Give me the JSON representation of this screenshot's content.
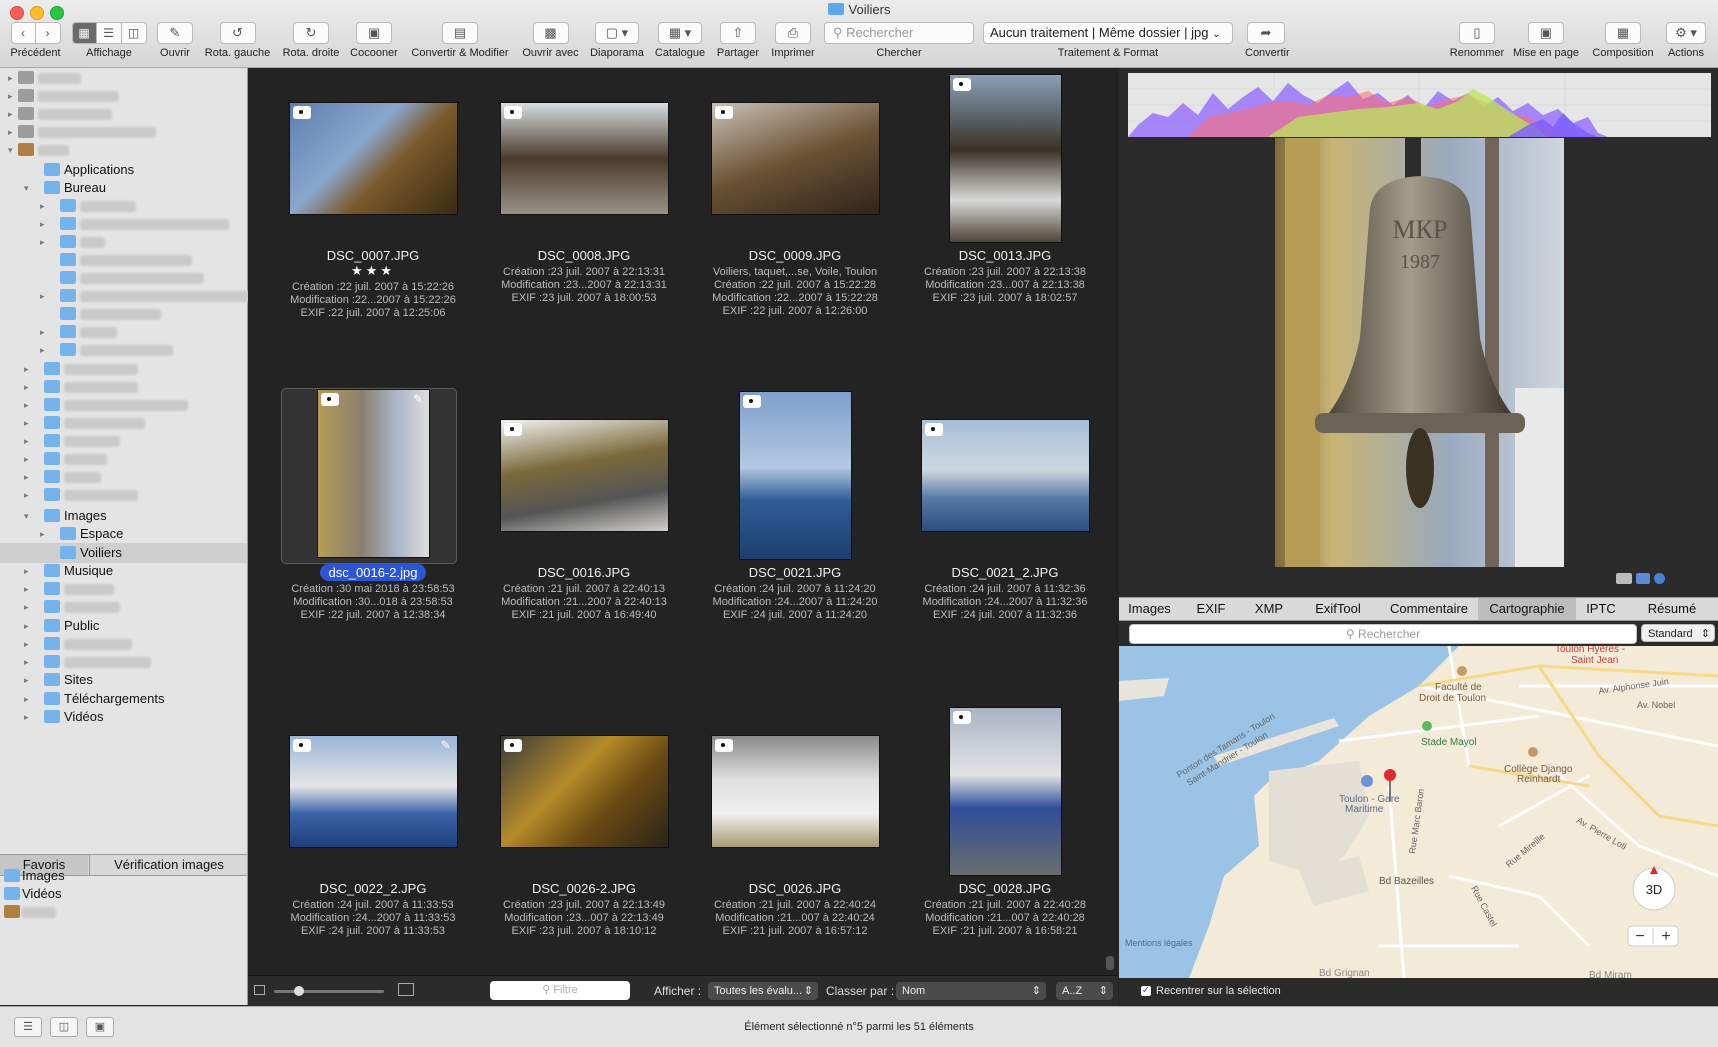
{
  "window": {
    "title": "Voiliers"
  },
  "toolbar": {
    "precedent": "Précédent",
    "affichage": "Affichage",
    "ouvrir": "Ouvrir",
    "rota_gauche": "Rota. gauche",
    "rota_droite": "Rota. droite",
    "cocooner": "Cocooner",
    "convertir_modifier": "Convertir & Modifier",
    "ouvrir_avec": "Ouvrir avec",
    "diaporama": "Diaporama",
    "catalogue": "Catalogue",
    "partager": "Partager",
    "imprimer": "Imprimer",
    "search_placeholder": "Rechercher",
    "chercher": "Chercher",
    "traitement_value": "Aucun traitement | Même dossier | jpg",
    "traitement_label": "Traitement & Format",
    "convertir": "Convertir",
    "renommer": "Renommer",
    "mise_en_page": "Mise en page",
    "composition": "Composition",
    "actions": "Actions"
  },
  "sidebar": {
    "rows": [
      {
        "label": "Mercure",
        "blurred": true,
        "level": 0
      },
      {
        "label": "macoft – sauv",
        "blurred": true,
        "level": 0
      },
      {
        "label": "Time Machine",
        "blurred": true,
        "level": 0
      },
      {
        "label": "GraphicConverter 10",
        "blurred": true,
        "level": 0
      },
      {
        "label": "macof",
        "blurred": true,
        "level": 0
      },
      {
        "label": "Applications",
        "blurred": false,
        "level": 1
      },
      {
        "label": "Bureau",
        "blurred": false,
        "level": 1
      },
      {
        "label": "Activites",
        "blurred": true,
        "level": 2
      },
      {
        "label": "Activites personnalisees",
        "blurred": true,
        "level": 2
      },
      {
        "label": "BBBB",
        "blurred": true,
        "level": 2
      },
      {
        "label": "dossier sans titre",
        "blurred": true,
        "level": 2
      },
      {
        "label": "dossier sans titre 2",
        "blurred": true,
        "level": 2
      },
      {
        "label": "Exemple d'arbre généalogique",
        "blurred": true,
        "level": 2
      },
      {
        "label": "Julia Roberts",
        "blurred": true,
        "level": 2
      },
      {
        "label": "photos",
        "blurred": true,
        "level": 2
      },
      {
        "label": "Présentation DC",
        "blurred": true,
        "level": 2
      },
      {
        "label": "Cloud Mac VF",
        "blurred": true,
        "level": 1
      },
      {
        "label": "CloudStation",
        "blurred": true,
        "level": 1
      },
      {
        "label": "Creative Cloud Files",
        "blurred": true,
        "level": 1
      },
      {
        "label": "Developpement",
        "blurred": true,
        "level": 1
      },
      {
        "label": "Documents",
        "blurred": true,
        "level": 1
      },
      {
        "label": "Dropbox",
        "blurred": true,
        "level": 1
      },
      {
        "label": "Github",
        "blurred": true,
        "level": 1
      },
      {
        "label": "Google Drive",
        "blurred": true,
        "level": 1
      },
      {
        "label": "Images",
        "blurred": false,
        "level": 1
      },
      {
        "label": "Espace",
        "blurred": false,
        "level": 2
      },
      {
        "label": "Voiliers",
        "blurred": false,
        "level": 2
      },
      {
        "label": "Musique",
        "blurred": false,
        "level": 1
      },
      {
        "label": "OneDrive",
        "blurred": true,
        "level": 1
      },
      {
        "label": "Parallels",
        "blurred": true,
        "level": 1
      },
      {
        "label": "Public",
        "blurred": false,
        "level": 1
      },
      {
        "label": "Sauvegardes",
        "blurred": true,
        "level": 1
      },
      {
        "label": "Shared with me",
        "blurred": true,
        "level": 1
      },
      {
        "label": "Sites",
        "blurred": false,
        "level": 1
      },
      {
        "label": "Téléchargements",
        "blurred": false,
        "level": 1
      },
      {
        "label": "Vidéos",
        "blurred": false,
        "level": 1
      }
    ],
    "tab_favoris": "Favoris",
    "tab_verification": "Vérification images",
    "favorites": [
      {
        "label": "Images"
      },
      {
        "label": "Vidéos"
      },
      {
        "label": "macof"
      }
    ]
  },
  "grid": {
    "items": [
      {
        "name": "DSC_0007.JPG",
        "stars": "★★★",
        "meta": [
          "Création :22 juil. 2007 à 15:22:26",
          "Modification :22...2007 à 15:22:26",
          "EXIF :22 juil. 2007 à 12:25:06"
        ]
      },
      {
        "name": "DSC_0008.JPG",
        "stars": "",
        "meta": [
          "Création :23 juil. 2007 à 22:13:31",
          "Modification :23...2007 à 22:13:31",
          "EXIF :23 juil. 2007 à 18:00:53"
        ]
      },
      {
        "name": "DSC_0009.JPG",
        "stars": "",
        "meta": [
          "Voiliers, taquet,...se, Voile, Toulon",
          "Création :22 juil. 2007 à 15:22:28",
          "Modification :22...2007 à 15:22:28",
          "EXIF :22 juil. 2007 à 12:26:00"
        ]
      },
      {
        "name": "DSC_0013.JPG",
        "stars": "",
        "meta": [
          "Création :23 juil. 2007 à 22:13:38",
          "Modification :23...007 à 22:13:38",
          "EXIF :23 juil. 2007 à 18:02:57"
        ]
      },
      {
        "name": "dsc_0016-2.jpg",
        "stars": "",
        "meta": [
          "Création :30 mai 2018 à 23:58:53",
          "Modification :30...018 à 23:58:53",
          "EXIF :22 juil. 2007 à 12:38:34"
        ]
      },
      {
        "name": "DSC_0016.JPG",
        "stars": "",
        "meta": [
          "Création :21 juil. 2007 à 22:40:13",
          "Modification :21...2007 à 22:40:13",
          "EXIF :21 juil. 2007 à 16:49:40"
        ]
      },
      {
        "name": "DSC_0021.JPG",
        "stars": "",
        "meta": [
          "Création :24 juil. 2007 à 11:24:20",
          "Modification :24...2007 à 11:24:20",
          "EXIF :24 juil. 2007 à 11:24:20"
        ]
      },
      {
        "name": "DSC_0021_2.JPG",
        "stars": "",
        "meta": [
          "Création :24 juil. 2007 à 11:32:36",
          "Modification :24...2007 à 11:32:36",
          "EXIF :24 juil. 2007 à 11:32:36"
        ]
      },
      {
        "name": "DSC_0022_2.JPG",
        "stars": "",
        "meta": [
          "Création :24 juil. 2007 à 11:33:53",
          "Modification :24...2007 à 11:33:53",
          "EXIF :24 juil. 2007 à 11:33:53"
        ]
      },
      {
        "name": "DSC_0026-2.JPG",
        "stars": "",
        "meta": [
          "Création :23 juil. 2007 à 22:13:49",
          "Modification :23...007 à 22:13:49",
          "EXIF :23 juil. 2007 à 18:10:12"
        ]
      },
      {
        "name": "DSC_0026.JPG",
        "stars": "",
        "meta": [
          "Création :21 juil. 2007 à 22:40:24",
          "Modification :21...007 à 22:40:24",
          "EXIF :21 juil. 2007 à 16:57:12"
        ]
      },
      {
        "name": "DSC_0028.JPG",
        "stars": "",
        "meta": [
          "Création :21 juil. 2007 à 22:40:28",
          "Modification :21...007 à 22:40:28",
          "EXIF :21 juil. 2007 à 16:58:21"
        ]
      }
    ],
    "filter_placeholder": "Filtre",
    "afficher_label": "Afficher :",
    "afficher_value": "Toutes les évalu...",
    "classer_label": "Classer par :",
    "classer_value": "Nom",
    "order_value": "A..Z"
  },
  "preview": {
    "bell_text": "МКР\n1987",
    "bell_line1": "МКР",
    "bell_line2": "1987"
  },
  "inspector": {
    "tabs": [
      "Images",
      "EXIF",
      "XMP",
      "ExifTool",
      "Commentaire",
      "Cartographie",
      "IPTC",
      "Résumé"
    ],
    "active_tab": "Cartographie",
    "map_search_placeholder": "Rechercher",
    "map_type": "Standard",
    "map_labels": {
      "hyeres": "Toulon Hyères -",
      "saint_jean": "Saint Jean",
      "faculte1": "Faculté de",
      "faculte2": "Droit de Toulon",
      "alphonse": "Av. Alphonse Juin",
      "nobel": "Av. Nobel",
      "stade": "Stade Mayol",
      "college1": "Collège Django",
      "college2": "Reinhardt",
      "gare1": "Toulon - Gare",
      "gare2": "Maritime",
      "ponton": "Ponton des Tamaris - Toulon",
      "saint_mandrier": "Saint-Mandrier - Toulon",
      "marc_baron": "Rue Marc Baron",
      "pierre_loti": "Av. Pierre Loti",
      "mireille": "Rue Mireille",
      "bazeilles": "Bd Bazeilles",
      "castel": "Rue Castel",
      "grignan": "Bd Grignan",
      "miramar": "Bd Miram",
      "mentions": "Mentions légales",
      "compass": "3D"
    },
    "recentrer": "Recentrer sur la sélection"
  },
  "status": {
    "text": "Élément sélectionné n°5 parmi les 51 éléments"
  },
  "colors": {
    "accent": "#2b57d6",
    "sidebar_bg": "#e4e4e4",
    "grid_bg": "#232323",
    "pin": "#e0282e"
  }
}
